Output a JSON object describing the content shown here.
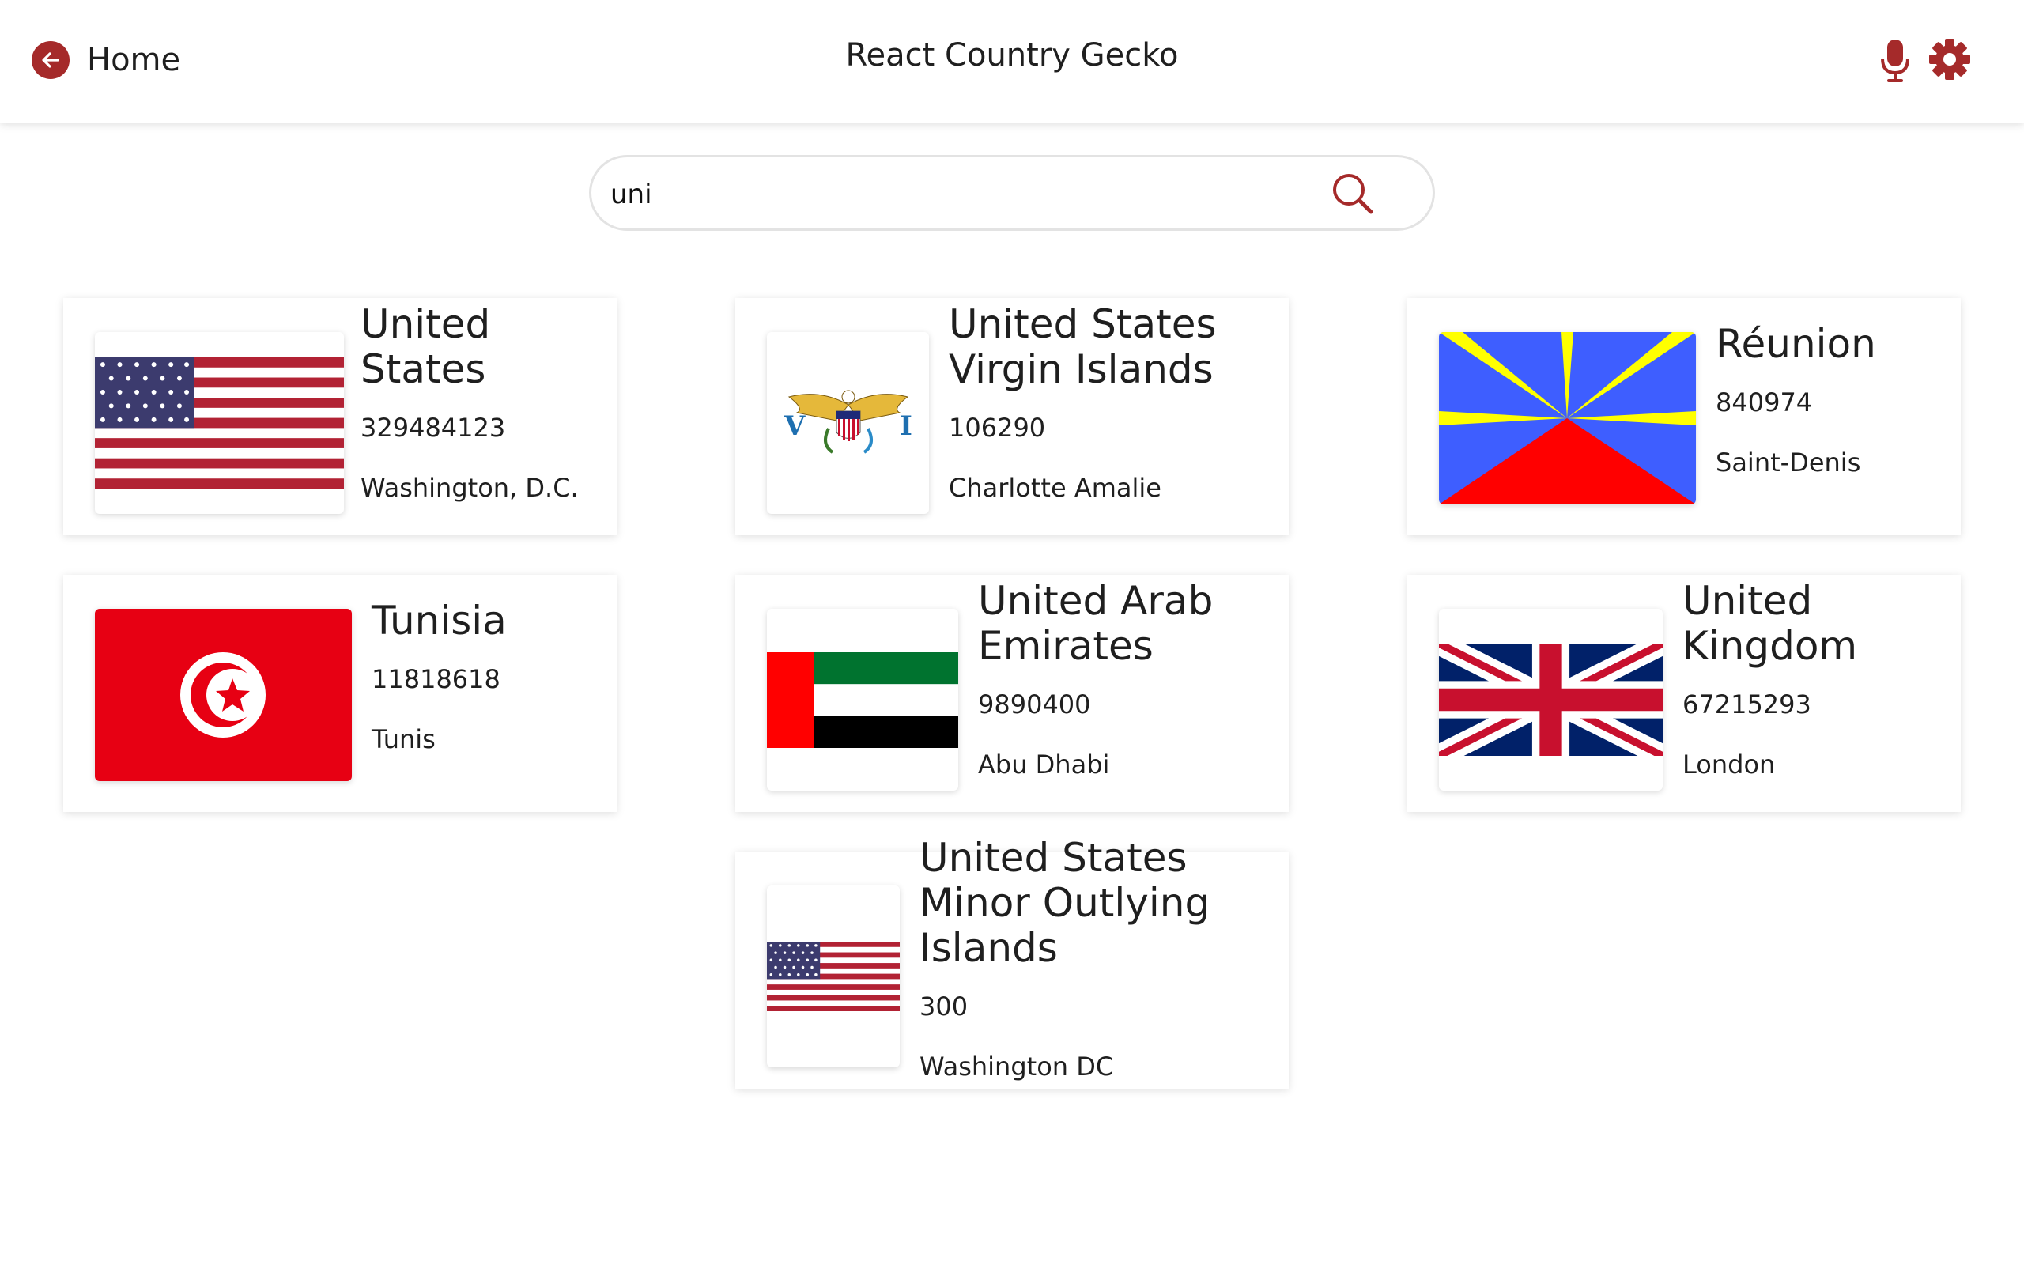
{
  "header": {
    "home_label": "Home",
    "title": "React Country Gecko",
    "icons": [
      "arrow-left-icon",
      "microphone-icon",
      "gear-icon"
    ],
    "accent_color": "#a52a2a"
  },
  "search": {
    "value": "uni",
    "icon": "search-icon"
  },
  "countries": [
    {
      "name": "United States",
      "population": "329484123",
      "capital": "Washington, D.C."
    },
    {
      "name": "United States Virgin Islands",
      "population": "106290",
      "capital": "Charlotte Amalie"
    },
    {
      "name": "Réunion",
      "population": "840974",
      "capital": "Saint-Denis"
    },
    {
      "name": "Tunisia",
      "population": "11818618",
      "capital": "Tunis"
    },
    {
      "name": "United Arab Emirates",
      "population": "9890400",
      "capital": "Abu Dhabi"
    },
    {
      "name": "United Kingdom",
      "population": "67215293",
      "capital": "London"
    },
    {
      "name": "United States Minor Outlying Islands",
      "population": "300",
      "capital": "Washington DC"
    }
  ],
  "vi_flag_letters": {
    "left": "V",
    "right": "I"
  }
}
